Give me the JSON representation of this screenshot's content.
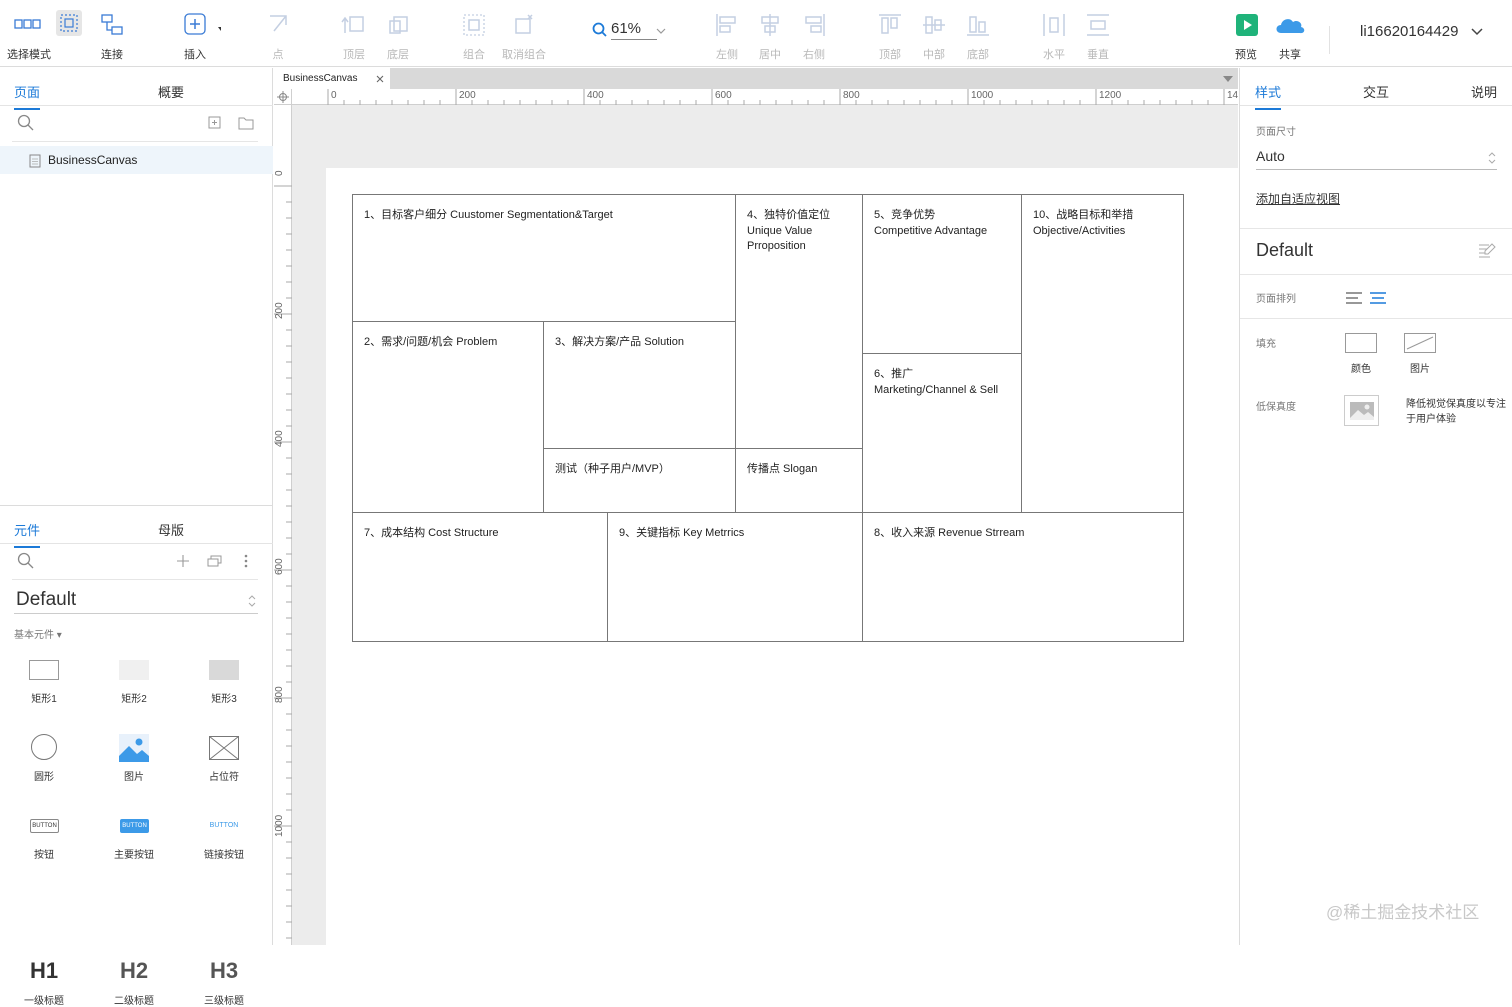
{
  "toolbar": {
    "select_mode": "选择模式",
    "connect": "连接",
    "insert": "插入",
    "point": "点",
    "top_layer": "顶层",
    "bottom_layer": "底层",
    "group": "组合",
    "ungroup": "取消组合",
    "zoom": "61%",
    "align_left": "左侧",
    "align_center": "居中",
    "align_right": "右侧",
    "align_top": "顶部",
    "align_middle": "中部",
    "align_bottom": "底部",
    "horizontal": "水平",
    "vertical": "垂直",
    "preview": "预览",
    "share": "共享",
    "user": "li16620164429"
  },
  "left": {
    "tabs": {
      "pages": "页面",
      "outline": "概要"
    },
    "page_item": "BusinessCanvas",
    "lib_tabs": {
      "widgets": "元件",
      "masters": "母版"
    },
    "library": "Default",
    "category": "基本元件 ▾",
    "widgets": [
      {
        "label": "矩形1",
        "icon": "rect1-icon"
      },
      {
        "label": "矩形2",
        "icon": "rect2-icon"
      },
      {
        "label": "矩形3",
        "icon": "rect3-icon"
      },
      {
        "label": "圆形",
        "icon": "circle-icon"
      },
      {
        "label": "图片",
        "icon": "image-icon"
      },
      {
        "label": "占位符",
        "icon": "placeholder-icon"
      },
      {
        "label": "按钮",
        "icon": "button-icon"
      },
      {
        "label": "主要按钮",
        "icon": "primary-button-icon"
      },
      {
        "label": "链接按钮",
        "icon": "link-button-icon"
      },
      {
        "label": "一级标题",
        "icon": "h1-icon"
      },
      {
        "label": "二级标题",
        "icon": "h2-icon"
      },
      {
        "label": "三级标题",
        "icon": "h3-icon"
      }
    ],
    "button_text": "BUTTON",
    "h1": "H1",
    "h2": "H2",
    "h3": "H3"
  },
  "canvas": {
    "doc_tab": "BusinessCanvas",
    "hruler": [
      "0",
      "200",
      "400",
      "600",
      "800",
      "1000",
      "1200",
      "14"
    ],
    "vruler": [
      "0",
      "200",
      "400",
      "600",
      "800",
      "1000"
    ],
    "cells": {
      "c1": "1、目标客户细分 Cuustomer Segmentation&Target",
      "c4": "4、独特价值定位\nUnique Value\nPrroposition",
      "c5": "5、竞争优势\nCompetitive Advantage",
      "c10": "10、战略目标和举措\nObjective/Activities",
      "c2": "2、需求/问题/机会 Problem",
      "c3": "3、解决方案/产品 Solution",
      "c6": "6、推广\nMarketing/Channel & Sell",
      "test": "测试（种子用户/MVP）",
      "slogan": "传播点 Slogan",
      "c7": "7、成本结构 Cost Structure",
      "c9": "9、关键指标 Key Metrrics",
      "c8": "8、收入来源 Revenue Strream"
    }
  },
  "right": {
    "tabs": {
      "style": "样式",
      "interaction": "交互",
      "notes": "说明"
    },
    "page_size_label": "页面尺寸",
    "page_size_value": "Auto",
    "adaptive_link": "添加自适应视图",
    "style_name": "Default",
    "page_align_label": "页面排列",
    "fill_label": "填充",
    "fill_color": "颜色",
    "fill_image": "图片",
    "low_fi_label": "低保真度",
    "low_fi_desc": "降低视觉保真度以专注于用户体验"
  },
  "watermark": "@稀土掘金技术社区",
  "colors": {
    "accent": "#1c7ad8",
    "preview_green": "#1fb37a",
    "share_blue": "#3c9ae8"
  }
}
